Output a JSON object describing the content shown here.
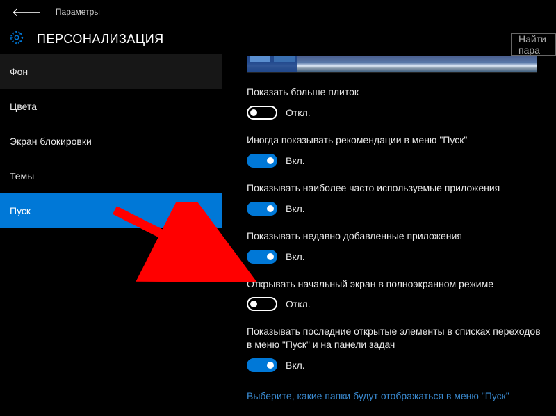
{
  "header": {
    "breadcrumb": "Параметры"
  },
  "page": {
    "title": "ПЕРСОНАЛИЗАЦИЯ"
  },
  "search": {
    "placeholder": "Найти пара"
  },
  "sidebar": {
    "items": [
      {
        "label": "Фон",
        "state": "hover"
      },
      {
        "label": "Цвета",
        "state": ""
      },
      {
        "label": "Экран блокировки",
        "state": ""
      },
      {
        "label": "Темы",
        "state": ""
      },
      {
        "label": "Пуск",
        "state": "active"
      }
    ]
  },
  "settings": [
    {
      "label": "Показать больше плиток",
      "on": false,
      "state_text": "Откл."
    },
    {
      "label": "Иногда показывать рекомендации в меню \"Пуск\"",
      "on": true,
      "state_text": "Вкл."
    },
    {
      "label": "Показывать наиболее часто используемые приложения",
      "on": true,
      "state_text": "Вкл."
    },
    {
      "label": "Показывать недавно добавленные приложения",
      "on": true,
      "state_text": "Вкл."
    },
    {
      "label": "Открывать начальный экран в полноэкранном режиме",
      "on": false,
      "state_text": "Откл."
    },
    {
      "label": "Показывать последние открытые элементы в списках переходов в меню \"Пуск\" и на панели задач",
      "on": true,
      "state_text": "Вкл."
    }
  ],
  "link": {
    "text": "Выберите, какие папки будут отображаться в меню \"Пуск\""
  }
}
